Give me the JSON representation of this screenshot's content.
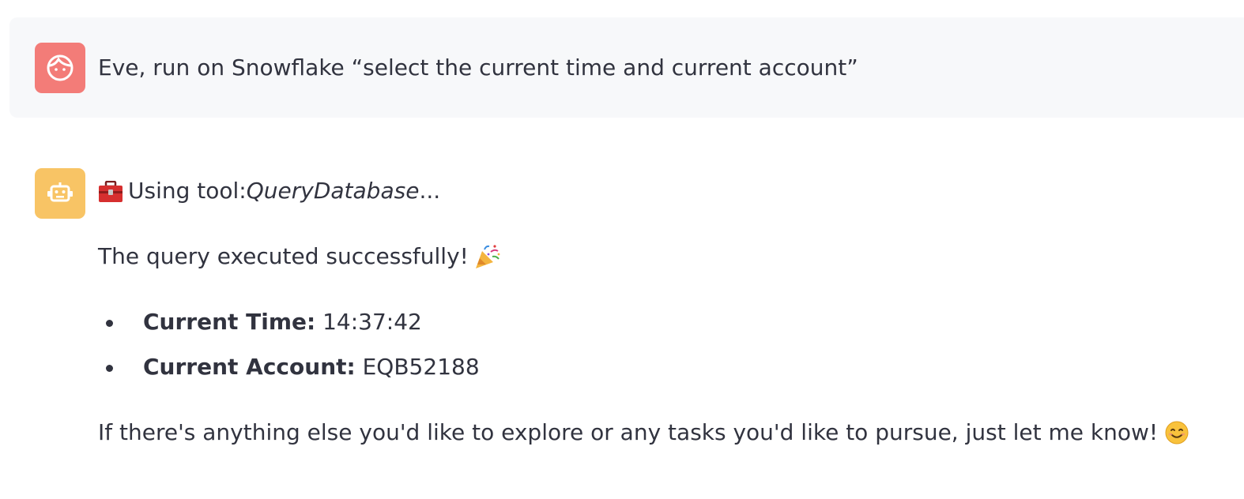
{
  "user_message": {
    "avatar_icon": "face-icon",
    "avatar_color": "#f37c78",
    "text": "Eve, run on Snowflake “select the current time and current account”"
  },
  "assistant_message": {
    "avatar_icon": "robot-icon",
    "avatar_color": "#f8c465",
    "tool_prefix": "Using tool: ",
    "tool_name": "QueryDatabase",
    "tool_suffix": "...",
    "tool_icon": "toolbox-icon",
    "success_text": "The query executed successfully!",
    "success_icon": "party-popper-icon",
    "results": [
      {
        "key": "Current Time:",
        "value": " 14:37:42"
      },
      {
        "key": "Current Account:",
        "value": " EQB52188"
      }
    ],
    "closing_text": "If there's anything else you'd like to explore or any tasks you'd like to pursue, just let me know!",
    "closing_icon": "smiling-face-icon"
  }
}
